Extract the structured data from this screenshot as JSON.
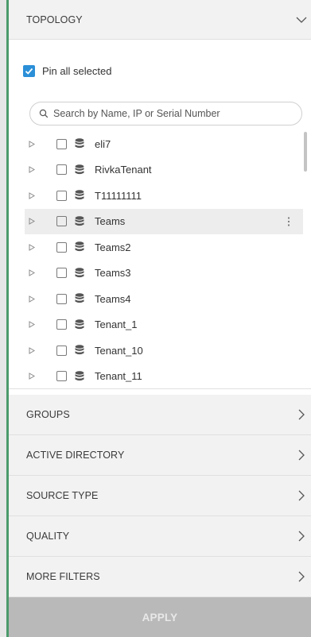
{
  "topology": {
    "title": "TOPOLOGY",
    "pin_all_label": "Pin all selected",
    "pin_all_checked": true,
    "search_placeholder": "Search by Name, IP or Serial Number",
    "items": [
      {
        "label": "eli7"
      },
      {
        "label": "RivkaTenant"
      },
      {
        "label": "T11111111"
      },
      {
        "label": "Teams"
      },
      {
        "label": "Teams2"
      },
      {
        "label": "Teams3"
      },
      {
        "label": "Teams4"
      },
      {
        "label": "Tenant_1"
      },
      {
        "label": "Tenant_10"
      },
      {
        "label": "Tenant_11"
      }
    ]
  },
  "filters": [
    {
      "title": "GROUPS"
    },
    {
      "title": "ACTIVE DIRECTORY"
    },
    {
      "title": "SOURCE TYPE"
    },
    {
      "title": "QUALITY"
    },
    {
      "title": "MORE FILTERS"
    }
  ],
  "apply_label": "APPLY",
  "colors": {
    "accent": "#4b9a6b",
    "checkbox": "#2b8fd8",
    "header_bg": "#f2f2f2",
    "apply_bg": "#b9b9b9",
    "hover_row": "#ededed"
  }
}
